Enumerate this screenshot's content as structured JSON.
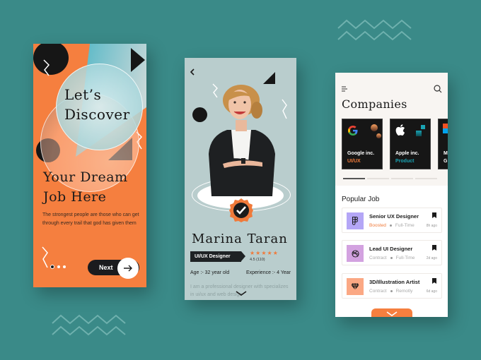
{
  "colors": {
    "background": "#3a8a88",
    "accent_orange": "#f57f3f",
    "dark": "#1b1b1e",
    "teal_label": "#1aa3b3"
  },
  "onboarding": {
    "heading_line1": "Let’s",
    "heading_line2": "Discover",
    "subheading_line1": "Your Dream",
    "subheading_line2": "Job Here",
    "description": "The strongest people are those who can get through every trail that god has given them",
    "page_count": 3,
    "active_page": 1,
    "next_label": "Next",
    "next_icon": "arrow-right-icon"
  },
  "profile": {
    "back_icon": "chevron-left-icon",
    "name": "Marina Taran",
    "role": "UI/UX Designer",
    "stars": "★★★★★",
    "rating_value": 4.5,
    "rating_text": "4.5 (110)",
    "age": "Age :- 32 year old",
    "experience": "Experience :- 4 Year",
    "bio": "I am a professional designer with specializes in ui/ux and web design",
    "verified_icon": "verified-badge-icon",
    "expand_icon": "chevron-down-icon"
  },
  "companies_screen": {
    "menu_icon": "hamburger-menu-icon",
    "search_icon": "search-icon",
    "title": "Companies",
    "companies": [
      {
        "name": "Google inc.",
        "category": "UI/UX",
        "category_color": "#f07a3a",
        "icon": "google-logo-icon"
      },
      {
        "name": "Apple inc.",
        "category": "Product",
        "category_color": "#1aa3b3",
        "icon": "apple-logo-icon"
      },
      {
        "name": "Mi",
        "category": "Gr",
        "category_color": "#ffffff",
        "icon": "microsoft-logo-icon"
      }
    ],
    "carousel_pages": 4,
    "carousel_active": 1,
    "popular_title": "Popular Job",
    "jobs": [
      {
        "title": "Senior UX Designer",
        "tag": "Boosted",
        "type": "Full-Time",
        "time": "8h ago",
        "icon": "figma-icon",
        "icon_bg": "#b4a6f6",
        "tag_color": "#f07a3a"
      },
      {
        "title": "Lead UI Designer",
        "tag": "Contract",
        "type": "Full-Time",
        "time": "2d ago",
        "icon": "dribbble-icon",
        "icon_bg": "#d3a2e0",
        "tag_color": "#aaaaaa"
      },
      {
        "title": "3D/Illustration Artist",
        "tag": "Contract",
        "type": "Remotly",
        "time": "6d ago",
        "icon": "diamond-icon",
        "icon_bg": "#fba884",
        "tag_color": "#aaaaaa"
      }
    ],
    "bookmark_icon": "bookmark-icon",
    "more_icon": "chevron-down-icon"
  }
}
